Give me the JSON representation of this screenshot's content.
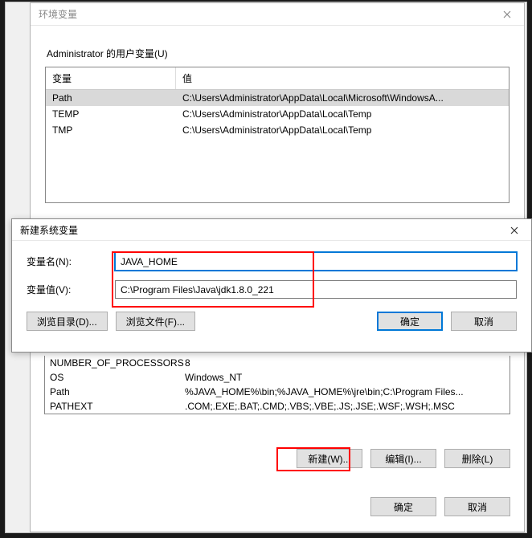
{
  "main_window": {
    "title": "环境变量",
    "user_vars_label": "Administrator 的用户变量(U)",
    "user_table": {
      "headers": {
        "var": "变量",
        "val": "值"
      },
      "rows": [
        {
          "var": "Path",
          "val": "C:\\Users\\Administrator\\AppData\\Local\\Microsoft\\WindowsA...",
          "selected": true
        },
        {
          "var": "TEMP",
          "val": "C:\\Users\\Administrator\\AppData\\Local\\Temp",
          "selected": false
        },
        {
          "var": "TMP",
          "val": "C:\\Users\\Administrator\\AppData\\Local\\Temp",
          "selected": false
        }
      ]
    },
    "sys_table": {
      "rows": [
        {
          "var": "NUMBER_OF_PROCESSORS",
          "val": "8"
        },
        {
          "var": "OS",
          "val": "Windows_NT"
        },
        {
          "var": "Path",
          "val": "%JAVA_HOME%\\bin;%JAVA_HOME%\\jre\\bin;C:\\Program Files..."
        },
        {
          "var": "PATHEXT",
          "val": ".COM;.EXE;.BAT;.CMD;.VBS;.VBE;.JS;.JSE;.WSF;.WSH;.MSC"
        }
      ]
    },
    "sys_buttons": {
      "new": "新建(W)...",
      "edit": "编辑(I)...",
      "delete": "删除(L)"
    },
    "bottom_buttons": {
      "ok": "确定",
      "cancel": "取消"
    }
  },
  "dialog": {
    "title": "新建系统变量",
    "name_label": "变量名(N):",
    "value_label": "变量值(V):",
    "name_value": "JAVA_HOME",
    "value_value": "C:\\Program Files\\Java\\jdk1.8.0_221",
    "browse_dir": "浏览目录(D)...",
    "browse_file": "浏览文件(F)...",
    "ok": "确定",
    "cancel": "取消"
  }
}
